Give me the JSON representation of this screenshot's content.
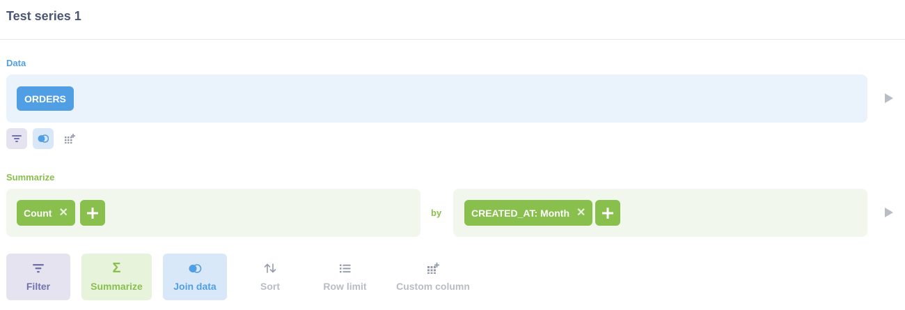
{
  "header": {
    "title": "Test series 1"
  },
  "data_section": {
    "label": "Data",
    "table_pill": "ORDERS"
  },
  "mini_actions": [
    {
      "icon": "filter-icon"
    },
    {
      "icon": "join-icon"
    },
    {
      "icon": "custom-column-icon"
    }
  ],
  "summarize_section": {
    "label": "Summarize",
    "metric": "Count",
    "by_label": "by",
    "breakout": "CREATED_AT: Month"
  },
  "actions": {
    "filter": {
      "label": "Filter",
      "icon": "filter-icon"
    },
    "summarize": {
      "label": "Summarize",
      "icon": "sigma-icon",
      "glyph": "Σ"
    },
    "join": {
      "label": "Join data",
      "icon": "join-icon"
    },
    "sort": {
      "label": "Sort",
      "icon": "sort-icon"
    },
    "row_limit": {
      "label": "Row limit",
      "icon": "list-icon"
    },
    "custom_column": {
      "label": "Custom column",
      "icon": "custom-column-icon"
    }
  },
  "colors": {
    "brand_blue": "#509ee3",
    "summarize_green": "#88bf4d",
    "filter_purple": "#7172ad",
    "text_dark": "#4c5773",
    "muted": "#b8bcc4"
  }
}
